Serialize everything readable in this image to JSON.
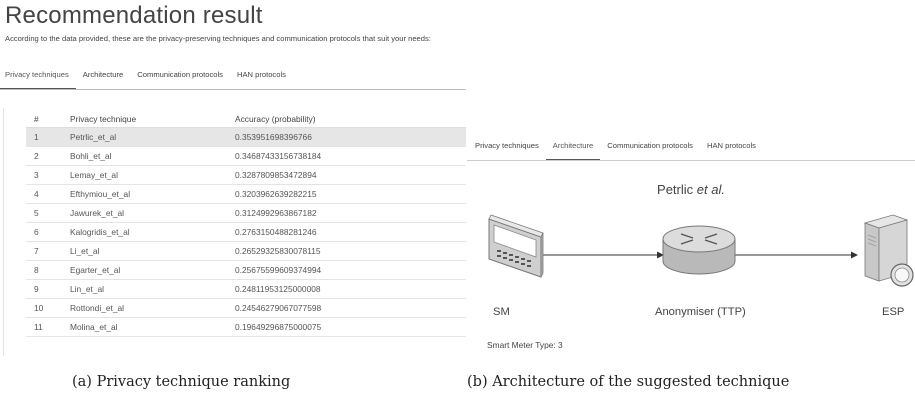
{
  "left_panel": {
    "title": "Recommendation result",
    "description": "According to the data provided, these are the privacy-preserving techniques and communication protocols that suit your needs:",
    "tabs": [
      {
        "label": "Privacy techniques",
        "active": true
      },
      {
        "label": "Architecture",
        "active": false
      },
      {
        "label": "Communication protocols",
        "active": false
      },
      {
        "label": "HAN protocols",
        "active": false
      }
    ],
    "table": {
      "headers": [
        "#",
        "Privacy technique",
        "Accuracy (probability)"
      ],
      "rows": [
        {
          "rank": "1",
          "technique": "Petrlic_et_al",
          "accuracy": "0.353951698396766",
          "selected": true
        },
        {
          "rank": "2",
          "technique": "Bohli_et_al",
          "accuracy": "0.34687433156738184"
        },
        {
          "rank": "3",
          "technique": "Lemay_et_al",
          "accuracy": "0.3287809853472894"
        },
        {
          "rank": "4",
          "technique": "Efthymiou_et_al",
          "accuracy": "0.3203962639282215"
        },
        {
          "rank": "5",
          "technique": "Jawurek_et_al",
          "accuracy": "0.3124992963867182"
        },
        {
          "rank": "6",
          "technique": "Kalogridis_et_al",
          "accuracy": "0.2763150488281246"
        },
        {
          "rank": "7",
          "technique": "Li_et_al",
          "accuracy": "0.26529325830078115"
        },
        {
          "rank": "8",
          "technique": "Egarter_et_al",
          "accuracy": "0.25675599609374994"
        },
        {
          "rank": "9",
          "technique": "Lin_et_al",
          "accuracy": "0.24811953125000008"
        },
        {
          "rank": "10",
          "technique": "Rottondi_et_al",
          "accuracy": "0.24546279067077598"
        },
        {
          "rank": "11",
          "technique": "Molina_et_al",
          "accuracy": "0.19649296875000075"
        }
      ]
    }
  },
  "right_panel": {
    "tabs": [
      {
        "label": "Privacy techniques",
        "active": false
      },
      {
        "label": "Architecture",
        "active": true
      },
      {
        "label": "Communication protocols",
        "active": false
      },
      {
        "label": "HAN protocols",
        "active": false
      }
    ],
    "diagram_title_plain": "Petrlic ",
    "diagram_title_italic": "et al.",
    "nodes": [
      {
        "label": "SM",
        "icon": "smart-meter-icon"
      },
      {
        "label": "Anonymiser (TTP)",
        "icon": "router-icon"
      },
      {
        "label": "ESP",
        "icon": "server-icon"
      }
    ],
    "smart_meter_type": "Smart Meter Type: 3"
  },
  "captions": {
    "left": "(a) Privacy technique ranking",
    "right": "(b) Architecture of the suggested technique"
  }
}
